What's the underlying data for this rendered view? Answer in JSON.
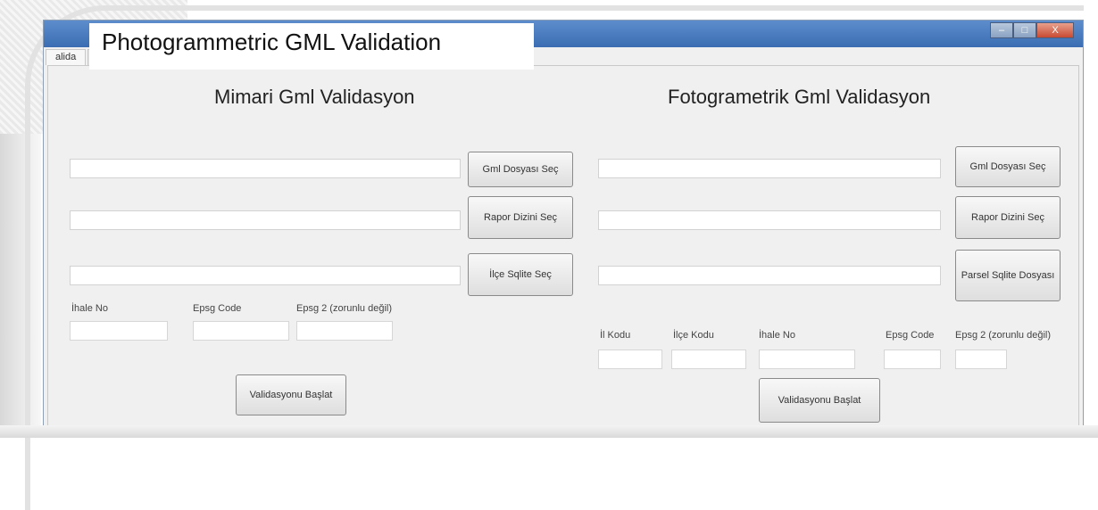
{
  "slide_title": "Photogrammetric GML Validation",
  "window": {
    "controls": [
      "–",
      "□",
      "X"
    ],
    "tabs": [
      "alida",
      ""
    ]
  },
  "left": {
    "title": "Mimari Gml Validasyon",
    "buttons": [
      "Gml Dosyası Seç",
      "Rapor Dizini Seç",
      "İlçe Sqlite Seç"
    ],
    "labels": [
      "İhale No",
      "Epsg Code",
      "Epsg 2 (zorunlu değil)"
    ],
    "start_button": "Validasyonu Başlat"
  },
  "right": {
    "title": "Fotogrametrik Gml Validasyon",
    "buttons": [
      "Gml Dosyası Seç",
      "Rapor Dizini Seç",
      "Parsel Sqlite Dosyası"
    ],
    "labels": [
      "İl Kodu",
      "İlçe Kodu",
      "İhale No",
      "Epsg Code",
      "Epsg 2 (zorunlu değil)"
    ],
    "start_button": "Validasyonu Başlat"
  }
}
